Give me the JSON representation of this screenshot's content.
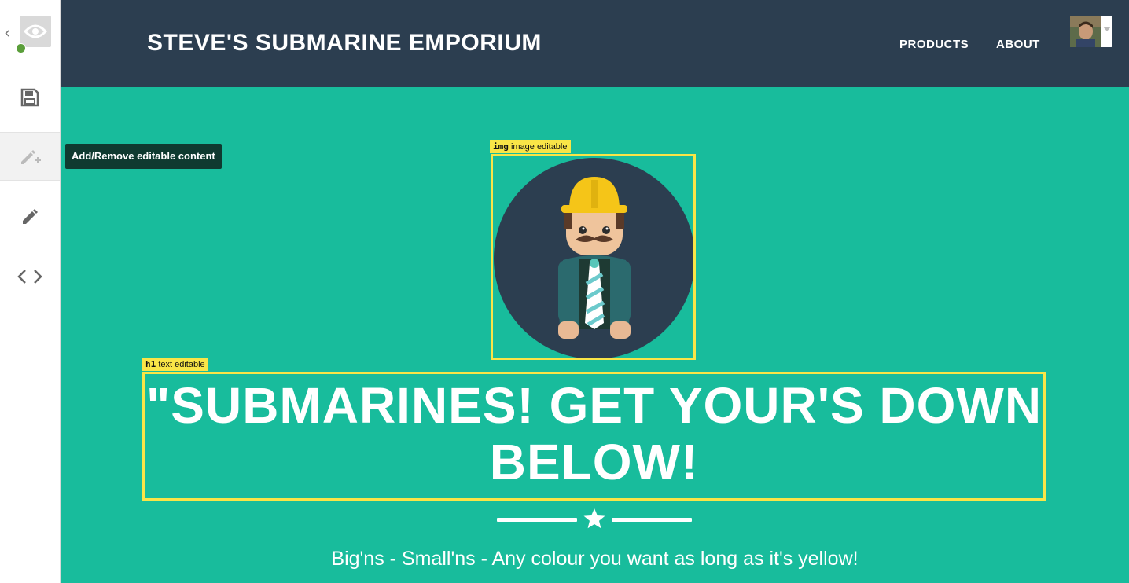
{
  "editor": {
    "sidebar": {
      "back_icon": "chevron-left-icon",
      "logo_icon": "eye-logo-icon",
      "status_icon": "check-status-icon",
      "save_icon": "floppy-disk-icon",
      "add_remove_icon": "pencil-plus-icon",
      "edit_icon": "pencil-icon",
      "code_icon": "code-brackets-icon"
    },
    "tooltip": "Add/Remove editable content"
  },
  "site": {
    "title": "STEVE'S SUBMARINE EMPORIUM",
    "nav": {
      "products": "PRODUCTS",
      "about": "ABOUT"
    },
    "user_caret_icon": "caret-down-icon"
  },
  "editable": {
    "image": {
      "tag": "img",
      "label": "image editable"
    },
    "heading": {
      "tag": "h1",
      "label": "text editable"
    }
  },
  "hero": {
    "heading": "\"SUBMARINES! GET YOUR'S DOWN BELOW!",
    "divider_icon": "star-icon",
    "tagline": "Big'ns - Small'ns - Any colour you want as long as it's yellow!"
  },
  "colors": {
    "header_bg": "#2c3e50",
    "page_bg": "#18bc9c",
    "editable_outline": "#f9e547",
    "tooltip_bg": "#0f3a30"
  }
}
